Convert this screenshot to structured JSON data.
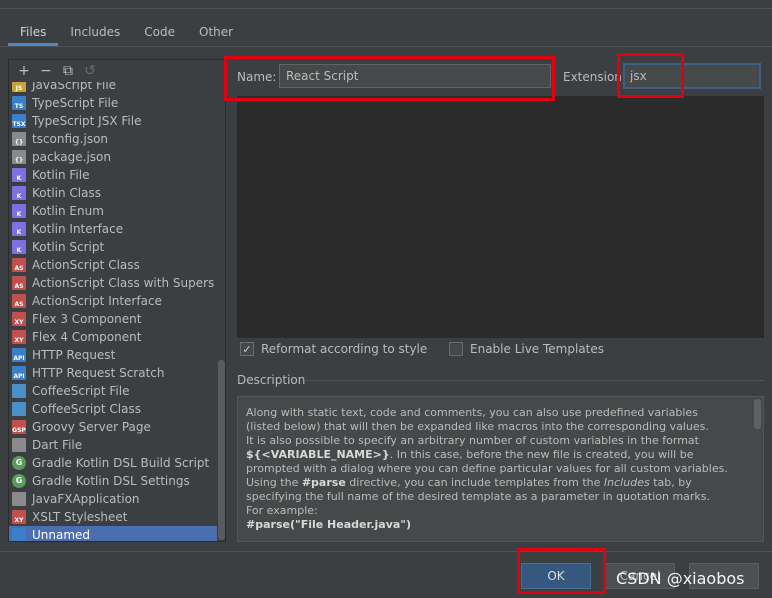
{
  "tabs": [
    {
      "label": "Files"
    },
    {
      "label": "Includes"
    },
    {
      "label": "Code"
    },
    {
      "label": "Other"
    }
  ],
  "toolbar": {
    "add": "+",
    "remove": "−",
    "copy": "⧉",
    "reset": "↺"
  },
  "templates": [
    {
      "label": "JavaScript File",
      "icon_text": "JS",
      "color": "#c8a23a"
    },
    {
      "label": "TypeScript File",
      "icon_text": "TS",
      "color": "#3a7fc8"
    },
    {
      "label": "TypeScript JSX File",
      "icon_text": "TSX",
      "color": "#3a7fc8"
    },
    {
      "label": "tsconfig.json",
      "icon_text": "{}",
      "color": "#8a8a8a"
    },
    {
      "label": "package.json",
      "icon_text": "{}",
      "color": "#8a8a8a"
    },
    {
      "label": "Kotlin File",
      "icon_text": "K",
      "color": "#7f6fe0"
    },
    {
      "label": "Kotlin Class",
      "icon_text": "K",
      "color": "#7f6fe0"
    },
    {
      "label": "Kotlin Enum",
      "icon_text": "K",
      "color": "#7f6fe0"
    },
    {
      "label": "Kotlin Interface",
      "icon_text": "K",
      "color": "#7f6fe0"
    },
    {
      "label": "Kotlin Script",
      "icon_text": "K",
      "color": "#7f6fe0"
    },
    {
      "label": "ActionScript Class",
      "icon_text": "AS",
      "color": "#c0504d"
    },
    {
      "label": "ActionScript Class with Supers",
      "icon_text": "AS",
      "color": "#c0504d"
    },
    {
      "label": "ActionScript Interface",
      "icon_text": "AS",
      "color": "#c0504d"
    },
    {
      "label": "Flex 3 Component",
      "icon_text": "XY",
      "color": "#c0504d"
    },
    {
      "label": "Flex 4 Component",
      "icon_text": "XY",
      "color": "#c0504d"
    },
    {
      "label": "HTTP Request",
      "icon_text": "API",
      "color": "#3a7fc8"
    },
    {
      "label": "HTTP Request Scratch",
      "icon_text": "API",
      "color": "#3a7fc8"
    },
    {
      "label": "CoffeeScript File",
      "icon_text": "",
      "color": "#4a8fc8"
    },
    {
      "label": "CoffeeScript Class",
      "icon_text": "",
      "color": "#4a8fc8"
    },
    {
      "label": "Groovy Server Page",
      "icon_text": "GSP",
      "color": "#c0504d"
    },
    {
      "label": "Dart File",
      "icon_text": "",
      "color": "#8a8a8a"
    },
    {
      "label": "Gradle Kotlin DSL Build Script",
      "icon_text": "G",
      "color": "#5a9a5a",
      "round": true
    },
    {
      "label": "Gradle Kotlin DSL Settings",
      "icon_text": "G",
      "color": "#5a9a5a",
      "round": true
    },
    {
      "label": "JavaFXApplication",
      "icon_text": "",
      "color": "#8a8a8a"
    },
    {
      "label": "XSLT Stylesheet",
      "icon_text": "XY",
      "color": "#c0504d"
    },
    {
      "label": "Unnamed",
      "icon_text": "",
      "color": "#3a7fc8",
      "selected": true
    }
  ],
  "form": {
    "name_label": "Name:",
    "name_value": "React Script",
    "extension_label": "Extension:",
    "extension_value": "jsx"
  },
  "options": {
    "reformat_label": "Reformat according to style",
    "reformat_checked": true,
    "live_templates_label": "Enable Live Templates",
    "live_templates_checked": false
  },
  "description": {
    "heading": "Description",
    "line1": "Along with static text, code and comments, you can also use predefined variables",
    "line2": "(listed below) that will then be expanded like macros into the corresponding values.",
    "line3": "It is also possible to specify an arbitrary number of custom variables in the format",
    "line4_bold": "${<VARIABLE_NAME>}",
    "line4_rest": ". In this case, before the new file is created, you will be",
    "line5": "prompted with a dialog where you can define particular values for all custom variables.",
    "line6_a": "Using the ",
    "line6_bold": "#parse",
    "line6_b": " directive, you can include templates from the ",
    "line6_italic": "Includes",
    "line6_c": " tab, by",
    "line7": "specifying the full name of the desired template as a parameter in quotation marks.",
    "line8": "For example:",
    "line9_bold": "#parse(\"File Header.java\")"
  },
  "buttons": {
    "ok": "OK",
    "cancel": "Cancel"
  },
  "watermark": "CSDN @xiaobos"
}
